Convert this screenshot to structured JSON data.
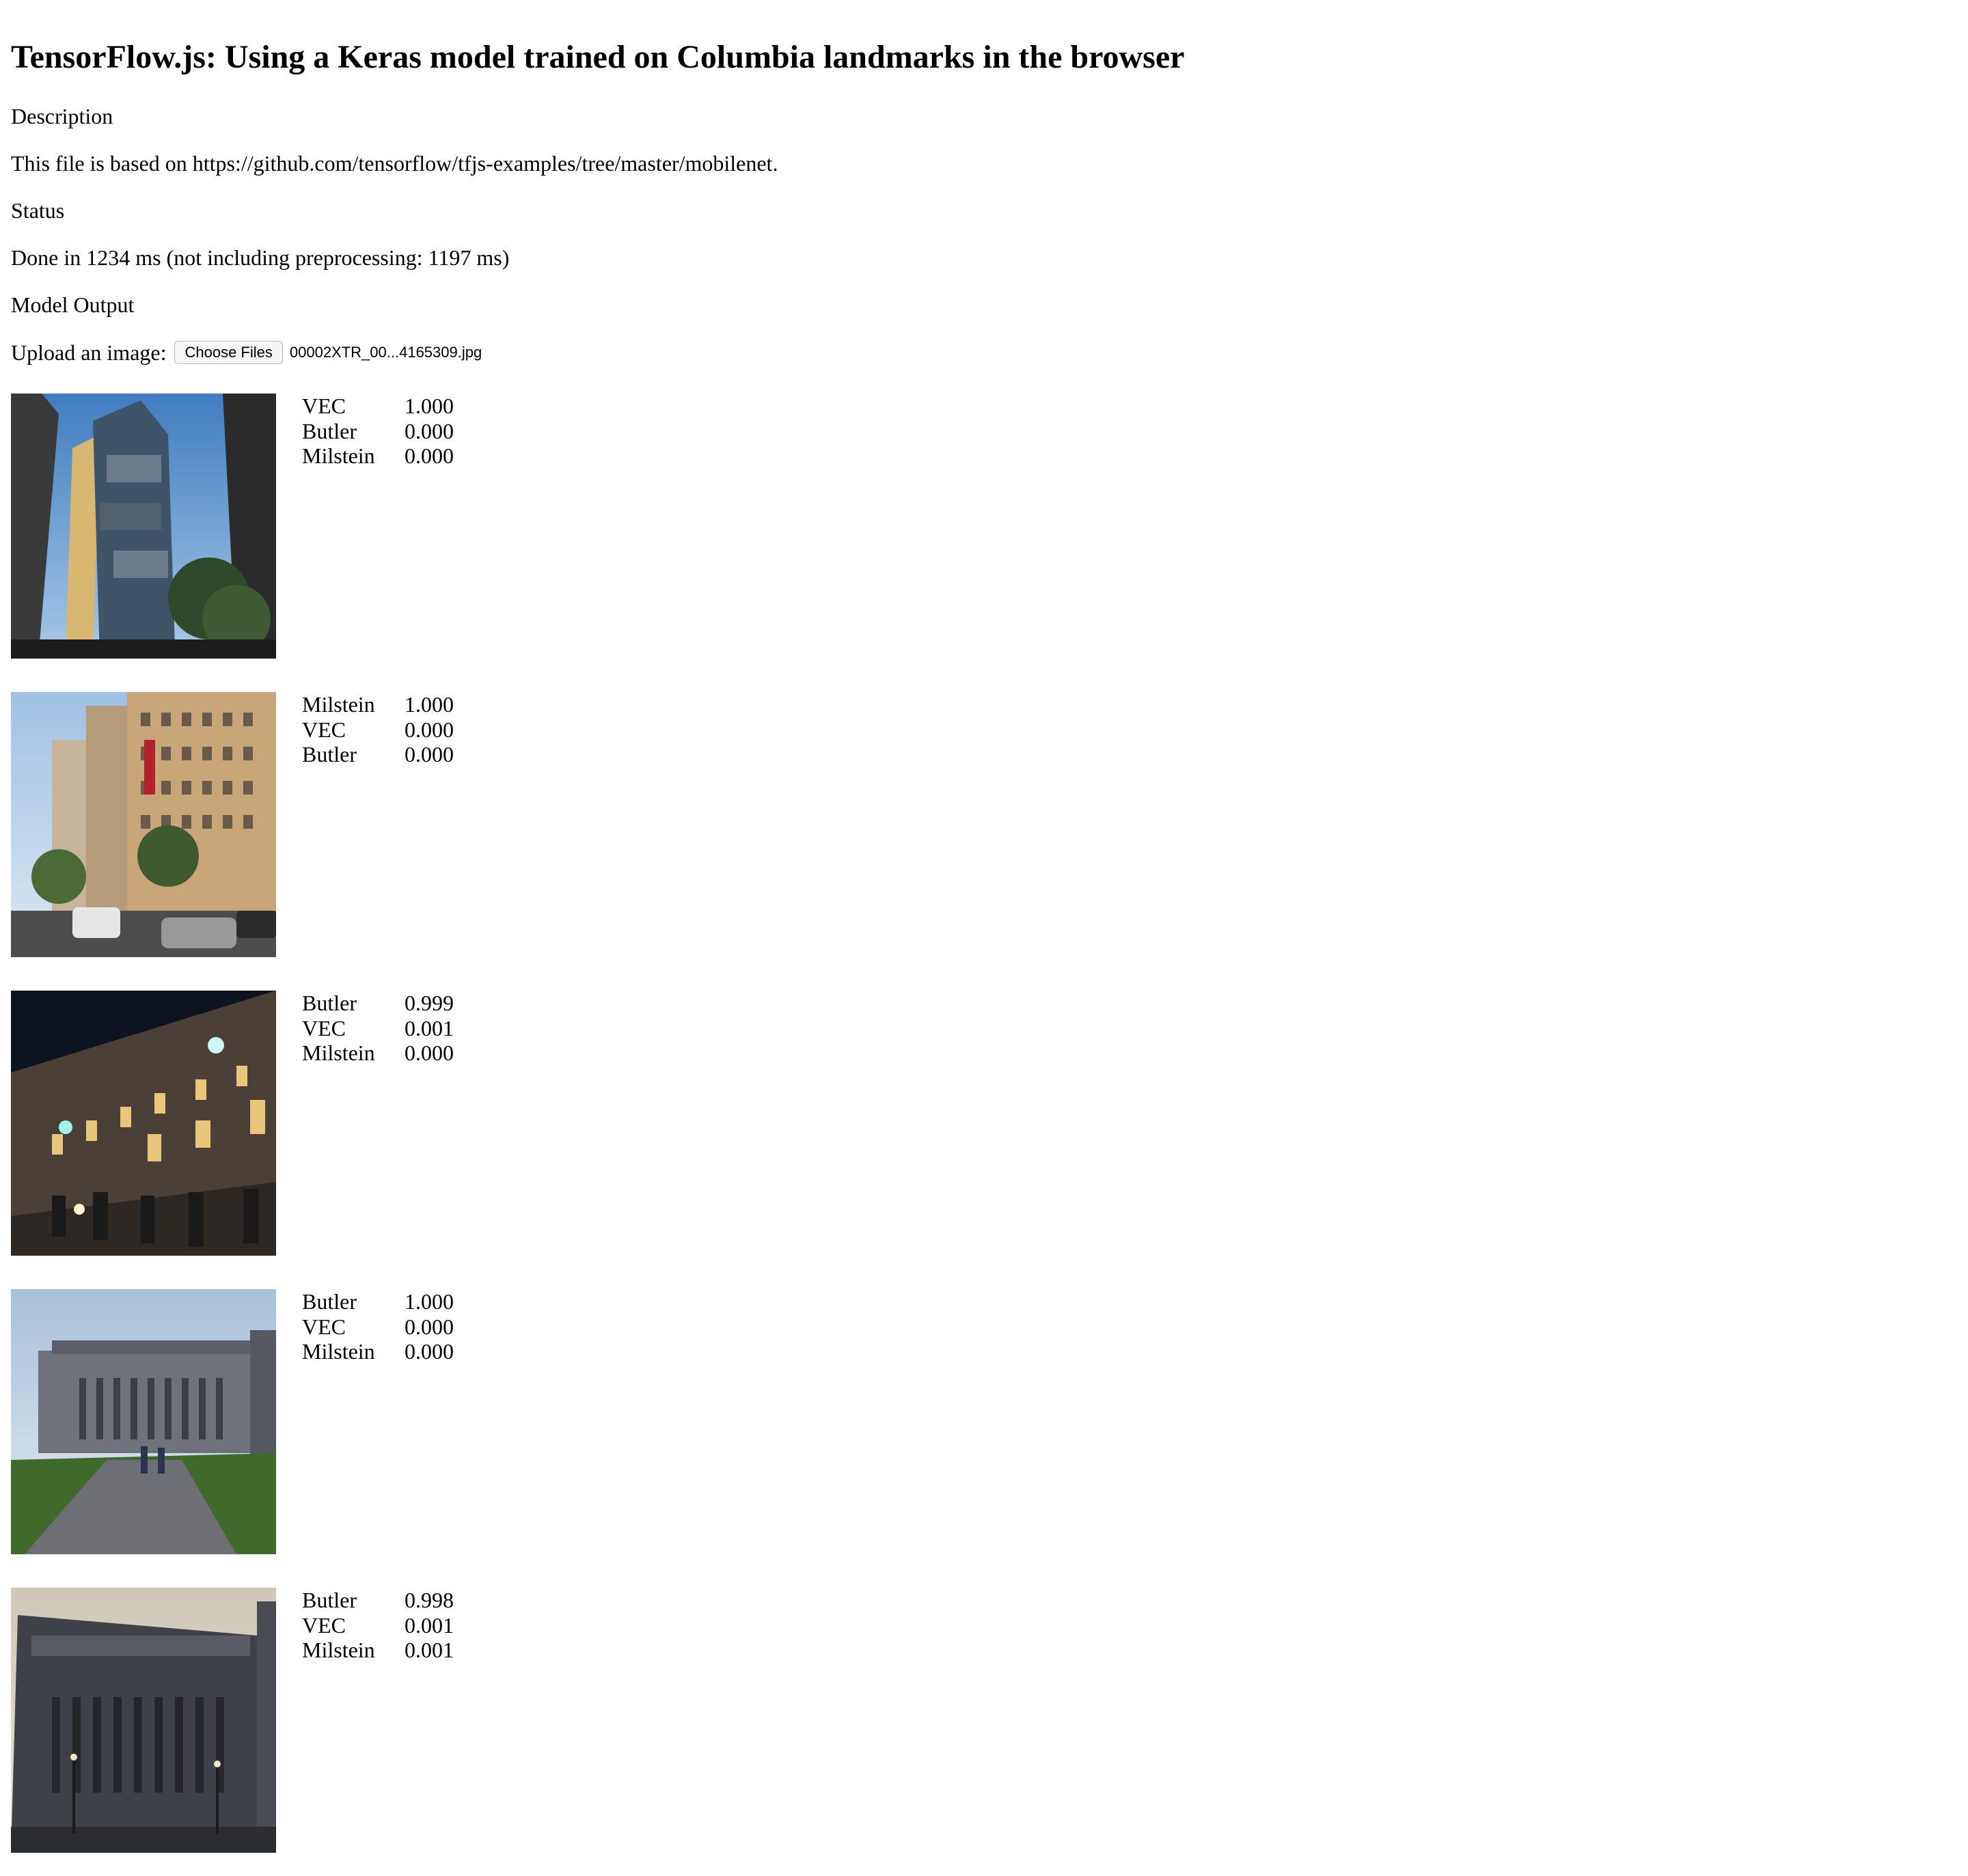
{
  "page": {
    "title": "TensorFlow.js: Using a Keras model trained on Columbia landmarks in the browser",
    "description_heading": "Description",
    "description_text": "This file is based on https://github.com/tensorflow/tfjs-examples/tree/master/mobilenet.",
    "status_heading": "Status",
    "status_text": "Done in 1234 ms (not including preprocessing: 1197 ms)",
    "output_heading": "Model Output"
  },
  "upload": {
    "label": "Upload an image:",
    "button_label": "Choose Files",
    "file_name": "00002XTR_00...4165309.jpg"
  },
  "results": [
    {
      "image": "modern-glass-tower-photo",
      "predictions": [
        {
          "label": "VEC",
          "prob": "1.000"
        },
        {
          "label": "Butler",
          "prob": "0.000"
        },
        {
          "label": "Milstein",
          "prob": "0.000"
        }
      ]
    },
    {
      "image": "street-buildings-photo",
      "predictions": [
        {
          "label": "Milstein",
          "prob": "1.000"
        },
        {
          "label": "VEC",
          "prob": "0.000"
        },
        {
          "label": "Butler",
          "prob": "0.000"
        }
      ]
    },
    {
      "image": "night-building-facade-photo",
      "predictions": [
        {
          "label": "Butler",
          "prob": "0.999"
        },
        {
          "label": "VEC",
          "prob": "0.001"
        },
        {
          "label": "Milstein",
          "prob": "0.000"
        }
      ]
    },
    {
      "image": "library-with-walkway-photo",
      "predictions": [
        {
          "label": "Butler",
          "prob": "1.000"
        },
        {
          "label": "VEC",
          "prob": "0.000"
        },
        {
          "label": "Milstein",
          "prob": "0.000"
        }
      ]
    },
    {
      "image": "library-facade-dusk-photo",
      "predictions": [
        {
          "label": "Butler",
          "prob": "0.998"
        },
        {
          "label": "VEC",
          "prob": "0.001"
        },
        {
          "label": "Milstein",
          "prob": "0.001"
        }
      ]
    }
  ]
}
